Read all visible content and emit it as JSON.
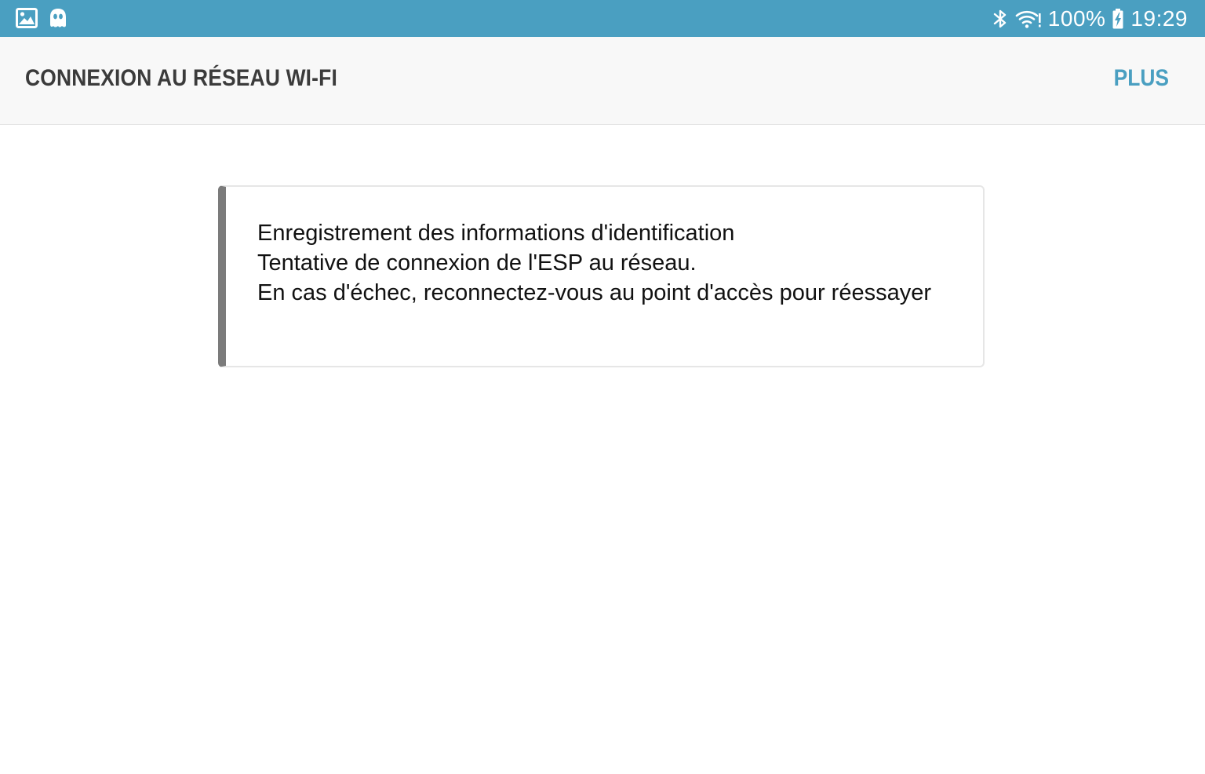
{
  "status_bar": {
    "left_icons": [
      "gallery-icon",
      "ghost-app-icon"
    ],
    "right_icons": [
      "bluetooth-icon",
      "wifi-icon",
      "battery-charging-icon"
    ],
    "battery_percent": "100%",
    "time": "19:29",
    "color": "#4a9fc1"
  },
  "app_bar": {
    "title": "CONNEXION AU RÉSEAU WI-FI",
    "more_label": "PLUS",
    "accent_color": "#4a9fc1"
  },
  "message": {
    "lines": [
      "Enregistrement des informations d'identification",
      "Tentative de connexion de l'ESP au réseau.",
      "En cas d'échec, reconnectez-vous au point d'accès pour réessayer"
    ],
    "border_color": "#7b7b7b"
  }
}
